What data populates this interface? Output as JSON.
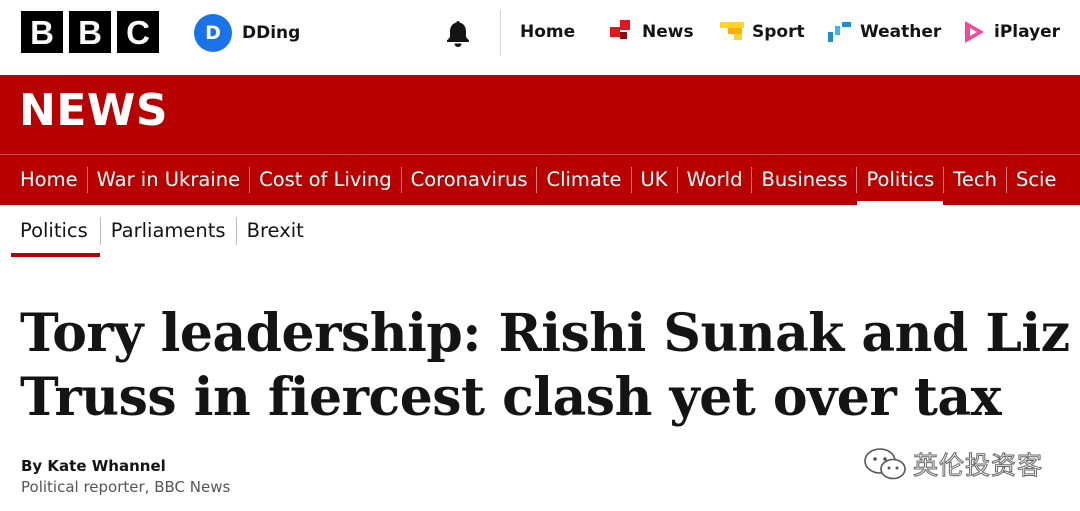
{
  "topbar": {
    "logo_letters": [
      "B",
      "B",
      "C"
    ],
    "account": {
      "initial": "D",
      "name": "DDing"
    },
    "notifications_icon": "bell-icon",
    "nav": [
      {
        "label": "Home",
        "icon": "none"
      },
      {
        "label": "News",
        "icon": "news-icon",
        "color": "#e3161b"
      },
      {
        "label": "Sport",
        "icon": "sport-icon",
        "color": "#ffd230"
      },
      {
        "label": "Weather",
        "icon": "weather-icon",
        "color": "#1f8ec9"
      },
      {
        "label": "iPlayer",
        "icon": "iplayer-icon",
        "color": "#f54997"
      }
    ]
  },
  "banner": {
    "wordmark": "NEWS",
    "color": "#b80000"
  },
  "primary_nav": {
    "items": [
      "Home",
      "War in Ukraine",
      "Cost of Living",
      "Coronavirus",
      "Climate",
      "UK",
      "World",
      "Business",
      "Politics",
      "Tech",
      "Scie"
    ],
    "active": "Politics"
  },
  "secondary_nav": {
    "items": [
      "Politics",
      "Parliaments",
      "Brexit"
    ],
    "active": "Politics"
  },
  "article": {
    "headline_line1": "Tory leadership: Rishi Sunak and Liz",
    "headline_line2": "Truss in fiercest clash yet over tax",
    "author": "By Kate Whannel",
    "role": "Political reporter, BBC News"
  },
  "watermark": {
    "text": "英伦投资客",
    "icon": "wechat-icon"
  }
}
